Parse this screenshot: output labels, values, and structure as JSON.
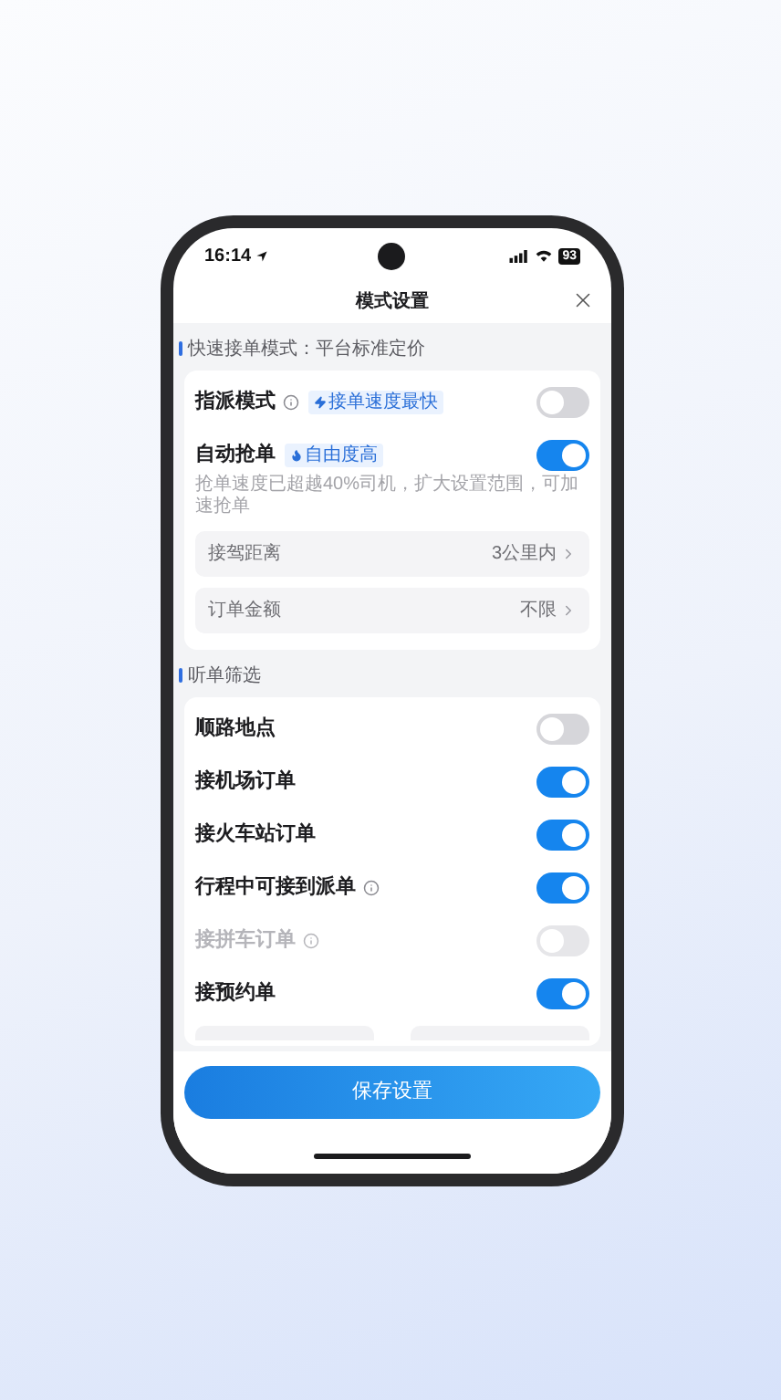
{
  "status_bar": {
    "time": "16:14",
    "battery": "93"
  },
  "header": {
    "title": "模式设置"
  },
  "sections": [
    {
      "title": "快速接单模式：平台标准定价",
      "rows": [
        {
          "kind": "toggle",
          "label": "指派模式",
          "info": true,
          "badge": "接单速度最快",
          "on": false,
          "disabled": false
        },
        {
          "kind": "toggle",
          "label": "自动抢单",
          "info": false,
          "badge": "自由度高",
          "on": true,
          "disabled": false,
          "hint": "抢单速度已超越40%司机，扩大设置范围，可加速抢单"
        },
        {
          "kind": "option",
          "label": "接驾距离",
          "value": "3公里内"
        },
        {
          "kind": "option",
          "label": "订单金额",
          "value": "不限"
        }
      ]
    },
    {
      "title": "听单筛选",
      "rows": [
        {
          "kind": "toggle",
          "label": "顺路地点",
          "info": false,
          "on": false,
          "disabled": false
        },
        {
          "kind": "toggle",
          "label": "接机场订单",
          "info": false,
          "on": true,
          "disabled": false
        },
        {
          "kind": "toggle",
          "label": "接火车站订单",
          "info": false,
          "on": true,
          "disabled": false
        },
        {
          "kind": "toggle",
          "label": "行程中可接到派单",
          "info": true,
          "on": true,
          "disabled": false
        },
        {
          "kind": "toggle",
          "label": "接拼车订单",
          "info": true,
          "on": false,
          "disabled": true
        },
        {
          "kind": "toggle",
          "label": "接预约单",
          "info": false,
          "on": true,
          "disabled": false
        },
        {
          "kind": "range"
        }
      ]
    }
  ],
  "save_button": "保存设置"
}
